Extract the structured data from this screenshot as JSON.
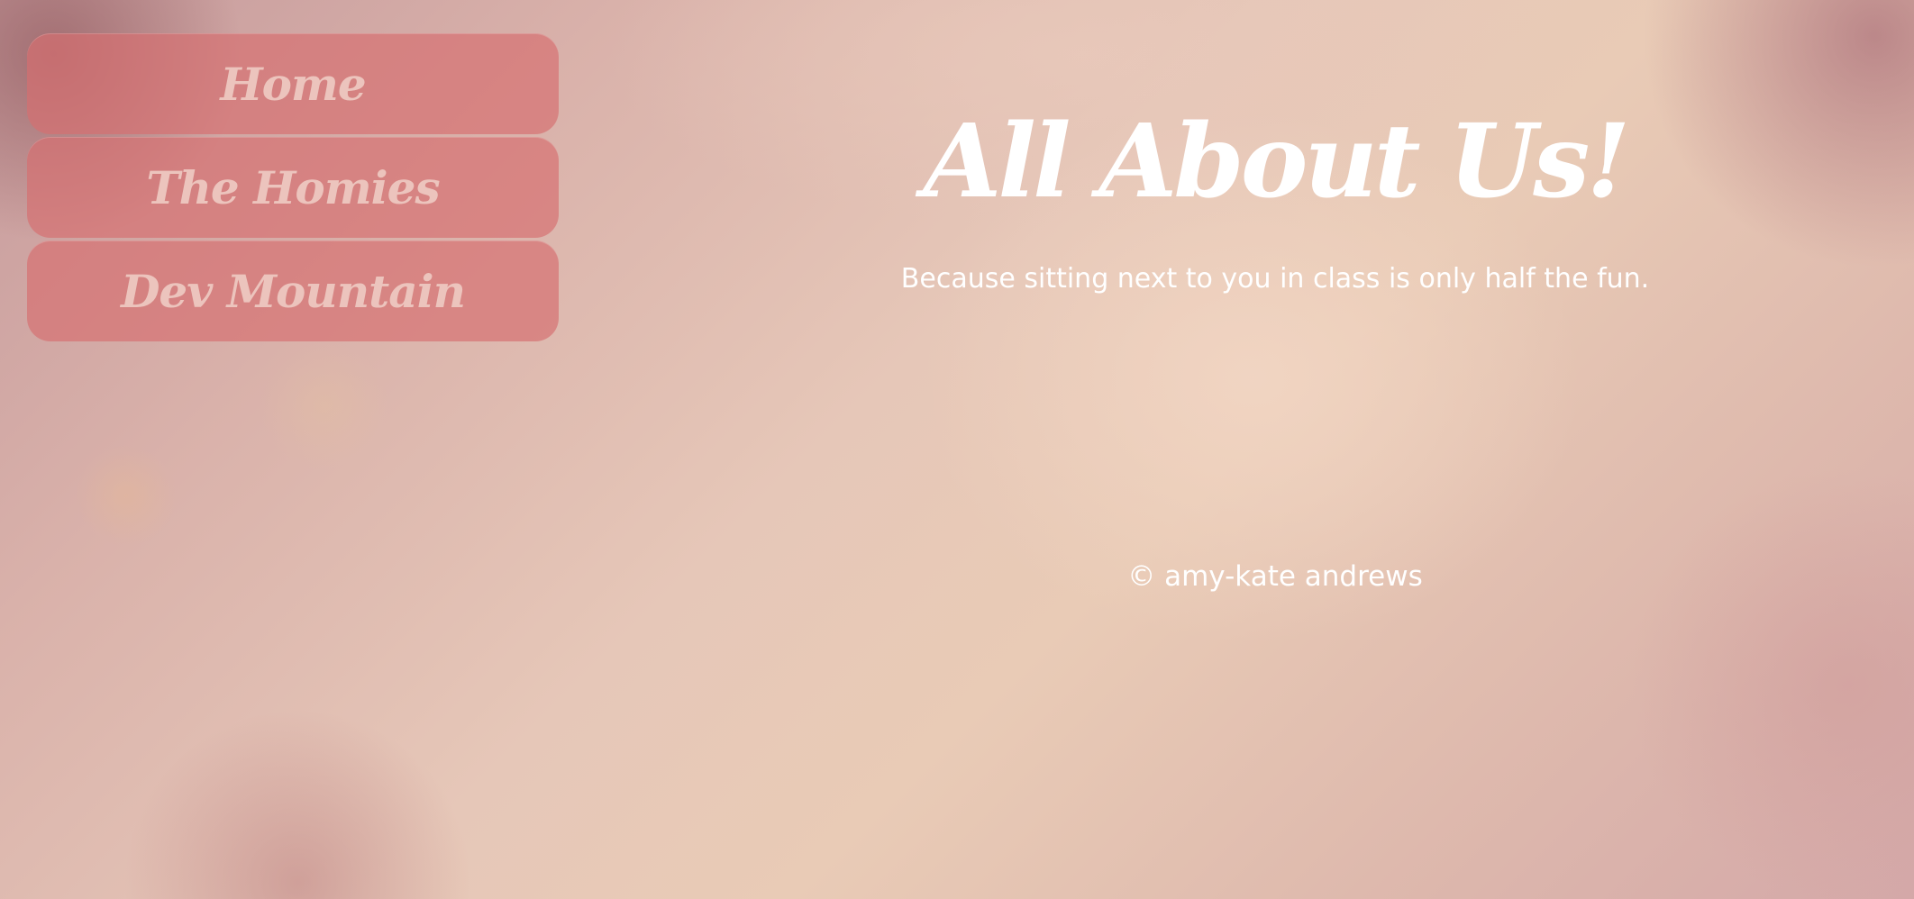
{
  "nav": {
    "items": [
      {
        "label": "Home"
      },
      {
        "label": "The Homies"
      },
      {
        "label": "Dev Mountain"
      }
    ]
  },
  "header": {
    "title": "All About Us!",
    "subtitle": "Because sitting next to you in class is only half the fun."
  },
  "footer": {
    "copyright": "© amy-kate andrews"
  },
  "colors": {
    "nav_button_bg": "#d66e70",
    "nav_text": "#ecc4bd",
    "text": "#ffffff"
  }
}
